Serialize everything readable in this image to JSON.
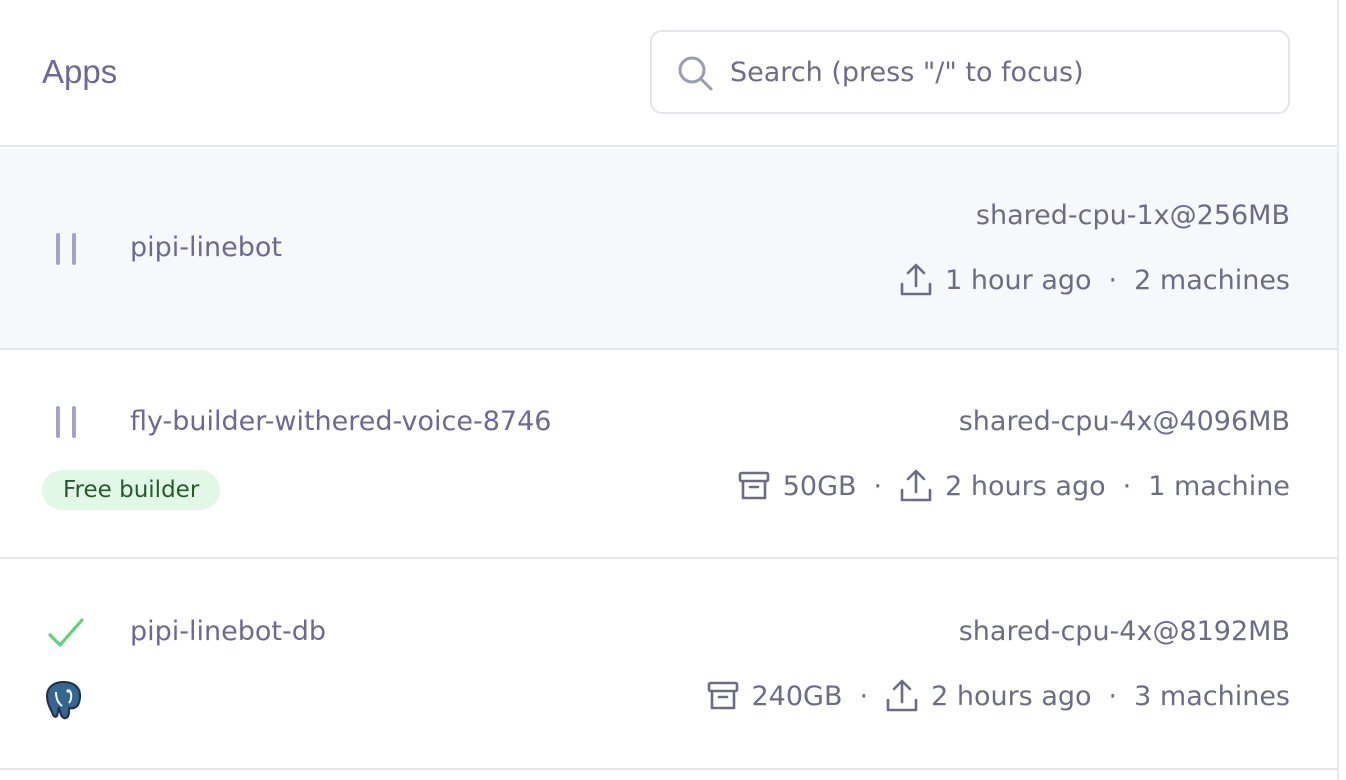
{
  "header": {
    "title": "Apps",
    "search": {
      "placeholder": "Search (press \"/\" to focus)",
      "value": "",
      "icon": "search-icon"
    }
  },
  "apps": [
    {
      "name": "pipi-linebot",
      "status": "suspended",
      "status_icon": "pause-icon",
      "machine_type": "shared-cpu-1x@256MB",
      "deployed": "1 hour ago",
      "machines": "2 machines",
      "selected": true
    },
    {
      "name": "fly-builder-withered-voice-8746",
      "status": "suspended",
      "status_icon": "pause-icon",
      "badge": "Free builder",
      "machine_type": "shared-cpu-4x@4096MB",
      "volume": "50GB",
      "deployed": "2 hours ago",
      "machines": "1 machine"
    },
    {
      "name": "pipi-linebot-db",
      "status": "running",
      "status_icon": "check-icon",
      "type_icon": "postgres-elephant-icon",
      "machine_type": "shared-cpu-4x@8192MB",
      "volume": "240GB",
      "deployed": "2 hours ago",
      "machines": "3 machines"
    }
  ],
  "separator": "·",
  "colors": {
    "accent_text": "#6f6896",
    "muted_text": "#6c6d85",
    "selected_row_bg": "#f7f8fb",
    "badge_bg": "#e2f8e6",
    "badge_text": "#27592f",
    "running_green": "#5fd27a",
    "pause_gray": "#a3a4c4"
  }
}
